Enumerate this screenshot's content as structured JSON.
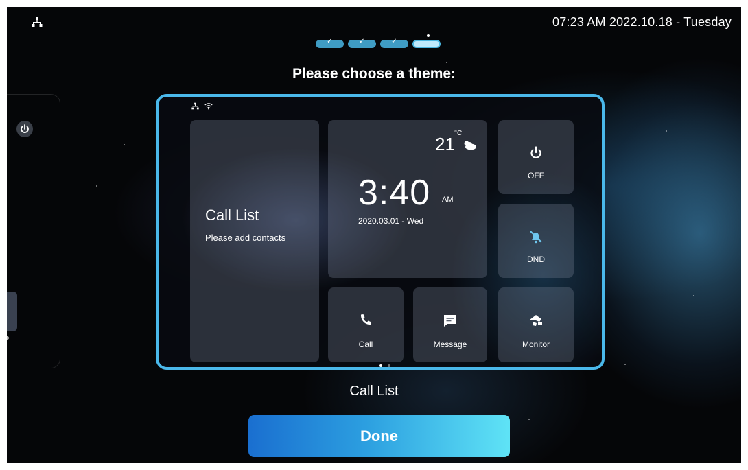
{
  "status_bar": {
    "datetime": "07:23 AM  2022.10.18 - Tuesday",
    "network_icon": "network-tree-icon"
  },
  "wizard": {
    "steps": [
      {
        "state": "done"
      },
      {
        "state": "done"
      },
      {
        "state": "done"
      },
      {
        "state": "current"
      }
    ],
    "prompt": "Please choose a theme:"
  },
  "preview": {
    "call_list": {
      "title": "Call List",
      "subtitle": "Please add contacts"
    },
    "clock": {
      "temperature": "21",
      "temperature_unit": "°C",
      "weather_icon": "partly-cloudy-icon",
      "time": "3:40",
      "ampm": "AM",
      "date": "2020.03.01 - Wed"
    },
    "tiles": {
      "off": {
        "label": "OFF",
        "icon": "power-icon"
      },
      "dnd": {
        "label": "DND",
        "icon": "bell-off-icon"
      },
      "call": {
        "label": "Call",
        "icon": "phone-icon"
      },
      "message": {
        "label": "Message",
        "icon": "message-icon"
      },
      "monitor": {
        "label": "Monitor",
        "icon": "camera-icon"
      }
    },
    "page_count": 2,
    "active_page": 1
  },
  "theme_name": "Call List",
  "done_label": "Done",
  "colors": {
    "accent": "#4ab8ea",
    "button_start": "#1a6fd0",
    "button_end": "#5fe3f6",
    "background": "#050608"
  }
}
